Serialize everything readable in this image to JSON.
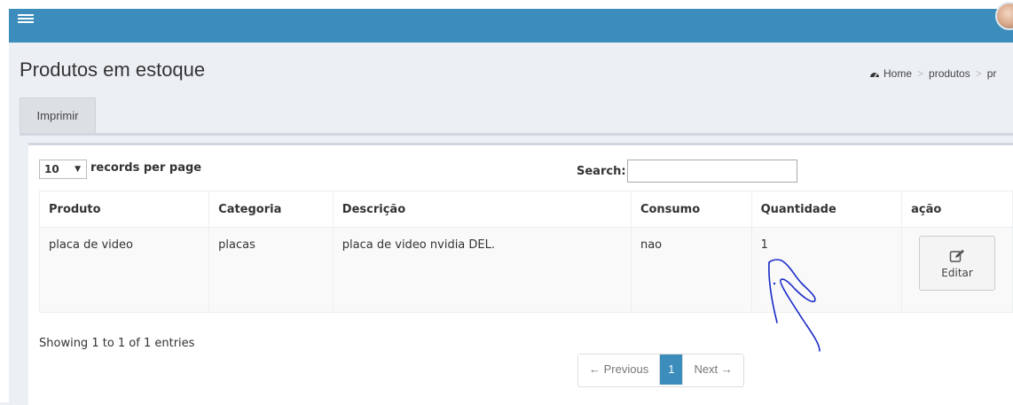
{
  "header": {
    "menu_icon": "hamburger-menu-icon",
    "avatar": "user-avatar",
    "bar_color": "#3c8dbc"
  },
  "page": {
    "title": "Produtos em estoque"
  },
  "breadcrumb": {
    "icon": "dashboard-icon",
    "items": [
      "Home",
      "produtos",
      "pr"
    ]
  },
  "tabs": {
    "print_label": "Imprimir"
  },
  "table_controls": {
    "page_length": "10",
    "records_label": "records per page",
    "search_label": "Search:",
    "search_value": ""
  },
  "table": {
    "headers": [
      "Produto",
      "Categoria",
      "Descrição",
      "Consumo",
      "Quantidade",
      "ação"
    ],
    "rows": [
      {
        "produto": "placa de video",
        "categoria": "placas",
        "descricao": "placa de video nvidia DEL.",
        "consumo": "nao",
        "quantidade": "1",
        "action_label": "Editar",
        "action_icon": "edit-icon"
      }
    ]
  },
  "footer": {
    "info": "Showing 1 to 1 of 1 entries"
  },
  "pagination": {
    "prev": "← Previous",
    "current": "1",
    "next": "Next →",
    "accent": "#3c8dbc"
  }
}
